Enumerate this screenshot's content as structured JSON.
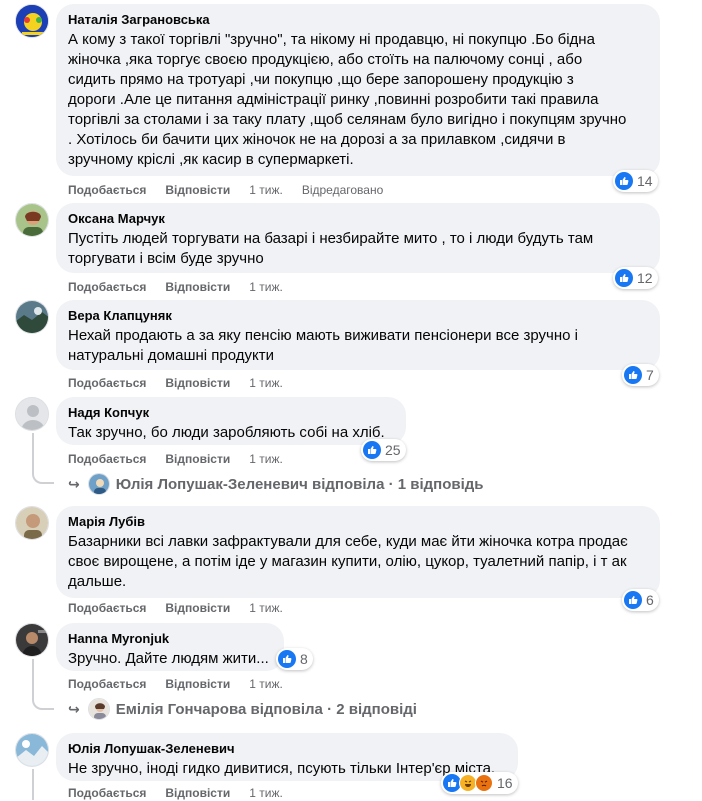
{
  "actions": {
    "like": "Подобається",
    "reply": "Відповісти"
  },
  "comments": [
    {
      "author": "Наталія Заграновська",
      "text": "А кому з такої торгівлі \"зручно\", та нікому ні продавцю, ні покупцю .Бо бідна\nжіночка ,яка торгує своєю продукцією, або стоїть на палючому сонці , або\nсидить прямо на тротуарі ,чи покупцю ,що бере запорошену продукцію з\nдороги .Але це питання адміністрації ринку ,повинні розробити такі правила\nторгівлі за столами і за таку плату ,щоб селянам було вигідно і покупцям зручно\n. Хотілось би бачити цих жіночок не на дорозі а за прилавком ,сидячи в\nзручному кріслі ,як касир в супермаркеті.",
      "time": "1 тиж.",
      "edited": "Відредаговано",
      "reactions": "14"
    },
    {
      "author": "Оксана Марчук",
      "text": "Пустіть людей торгувати на базарі і незбирайте мито , то і люди будуть там\nторгувати і всім буде зручно",
      "time": "1 тиж.",
      "reactions": "12"
    },
    {
      "author": "Вера Клапцуняк",
      "text": "Нехай продають а за яку пенсію мають виживати пенсіонери все зручно і\nнатуральні домашні продукти",
      "time": "1 тиж.",
      "reactions": "7"
    },
    {
      "author": "Надя Копчук",
      "text": "Так зручно, бо люди заробляють собі на хліб.",
      "time": "1 тиж.",
      "reactions": "25",
      "reply_summary": "Юлія Лопушак-Зеленевич відповіла · 1 відповідь"
    },
    {
      "author": "Марія Лубів",
      "text": "Базарники всі лавки зафрактували для себе, куди має йти жіночка котра продає\nсвоє вирощене, а потім іде у магазин купити, олію, цукор, туалетний папір, і т ак\nдальше.",
      "time": "1 тиж.",
      "reactions": "6"
    },
    {
      "author": "Hanna Myronjuk",
      "text": "Зручно. Дайте людям жити...",
      "time": "1 тиж.",
      "reactions": "8",
      "reply_summary": "Емілія Гончарова відповіла · 2 відповіді"
    },
    {
      "author": "Юлія Лопушак-Зеленевич",
      "text": "Не зручно, іноді гидко дивитися, псують тільки Інтер'єр міста.",
      "time": "1 тиж.",
      "reactions": "16"
    }
  ]
}
